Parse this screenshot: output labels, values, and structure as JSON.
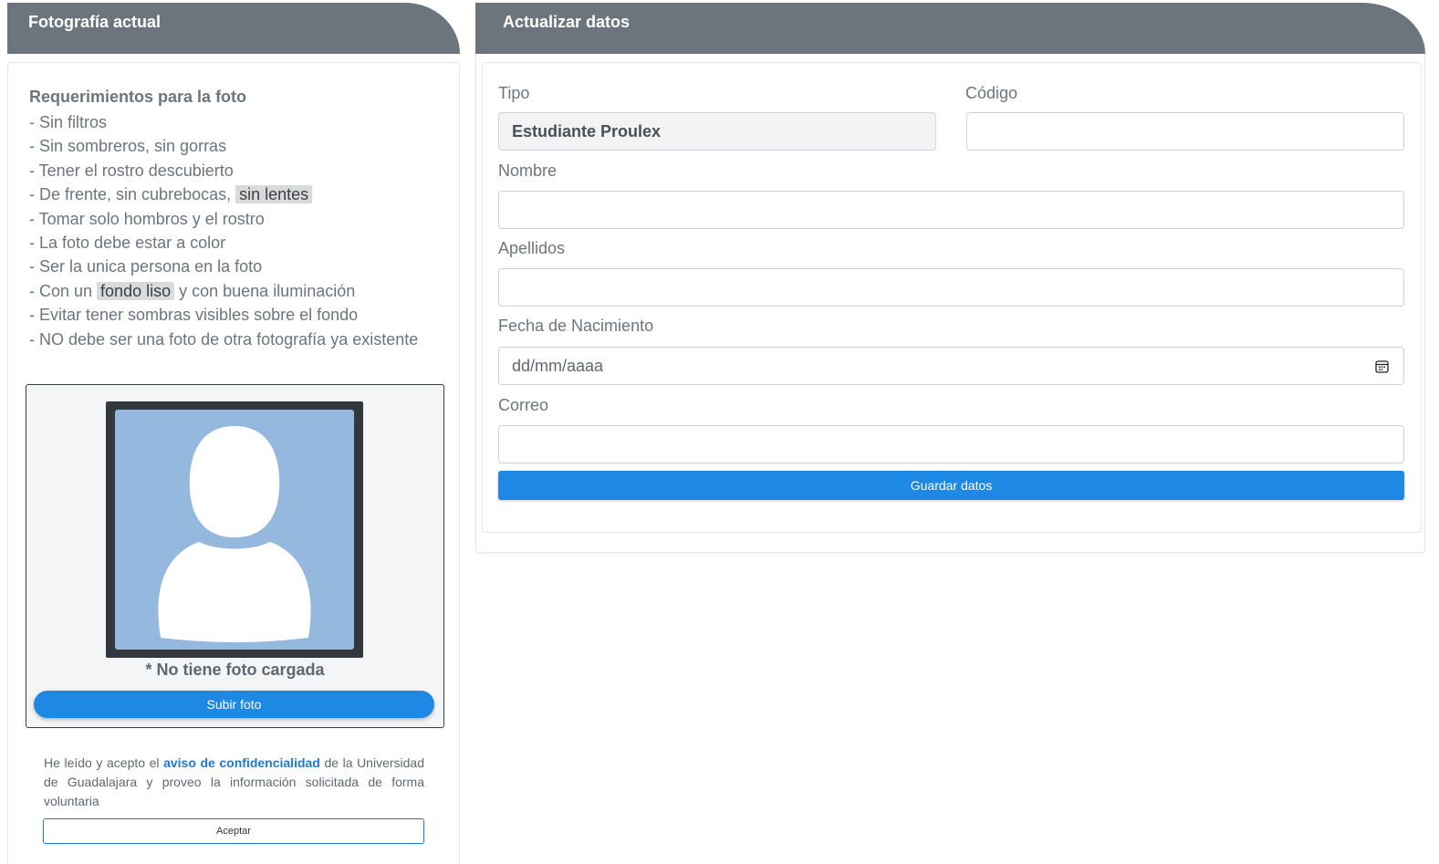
{
  "photo_panel": {
    "title": "Fotografía actual",
    "requirements_title": "Requerimientos para la foto",
    "requirements": [
      {
        "text": "- Sin filtros"
      },
      {
        "text": "- Sin sombreros, sin gorras"
      },
      {
        "text": "- Tener el rostro descubierto"
      },
      {
        "text": "- De frente, sin cubrebocas, ",
        "highlight": "sin lentes",
        "after": ""
      },
      {
        "text": "- Tomar solo hombros y el rostro"
      },
      {
        "text": "- La foto debe estar a color"
      },
      {
        "text": "- Ser la unica persona en la foto"
      },
      {
        "text": "- Con un ",
        "highlight": "fondo liso",
        "after": " y con buena iluminación"
      },
      {
        "text": "- Evitar tener sombras visibles sobre el fondo"
      },
      {
        "text": "- NO debe ser una foto de otra fotografía ya existente"
      }
    ],
    "avatar_icon": "user-silhouette-icon",
    "no_photo_text": "* No tiene foto cargada",
    "upload_button": "Subir foto",
    "consent": {
      "before": "He leído y acepto el ",
      "link": "aviso de confidencialidad",
      "after": " de la Universidad de Guadalajara y proveo la información solicitada de forma voluntaria"
    },
    "accept_button": "Aceptar"
  },
  "data_panel": {
    "title": "Actualizar datos",
    "fields": {
      "tipo": {
        "label": "Tipo",
        "value": "Estudiante Proulex"
      },
      "codigo": {
        "label": "Código",
        "value": ""
      },
      "nombre": {
        "label": "Nombre",
        "value": ""
      },
      "apellidos": {
        "label": "Apellidos",
        "value": ""
      },
      "fecha": {
        "label": "Fecha de Nacimiento",
        "placeholder": "dd/mm/aaaa",
        "icon": "calendar-icon"
      },
      "correo": {
        "label": "Correo",
        "value": ""
      }
    },
    "save_button": "Guardar datos"
  },
  "colors": {
    "header": "#6c757d",
    "primary": "#1e88e5",
    "avatar_bg": "#94b8de",
    "frame": "#33383e"
  }
}
